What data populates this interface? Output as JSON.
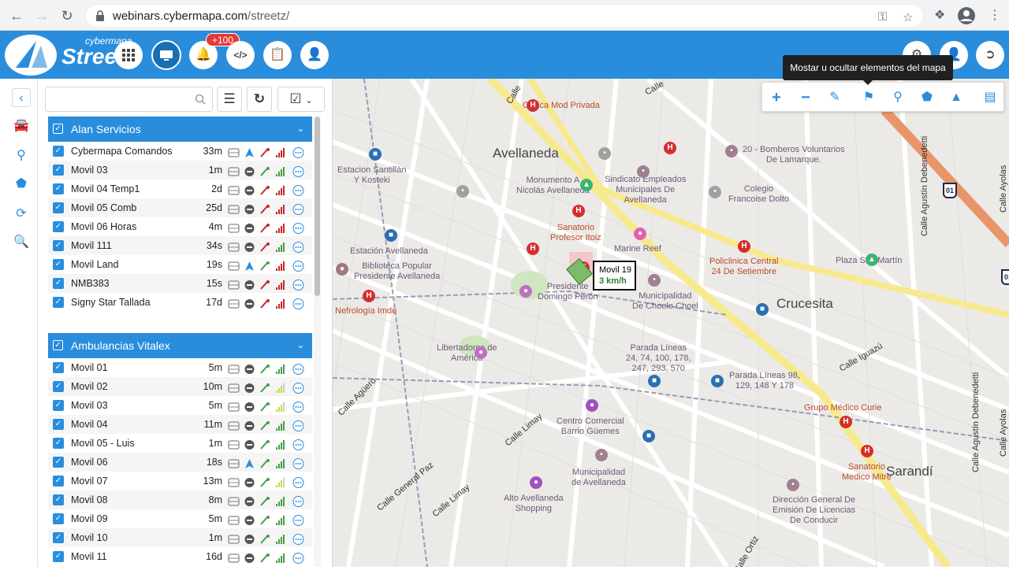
{
  "browser": {
    "url_domain": "webinars.cybermapa.com",
    "url_path": "/streetz/"
  },
  "header": {
    "logo_brand": "cybermapa",
    "logo_product": "Street",
    "notifications_badge": "+100"
  },
  "panel": {
    "search": {
      "value": "",
      "placeholder": ""
    },
    "groups": [
      {
        "name": "Alan Servicios",
        "rows": [
          {
            "name": "Cybermapa Comandos",
            "time": "33m"
          },
          {
            "name": "Movil 03",
            "time": "1m"
          },
          {
            "name": "Movil 04 Temp1",
            "time": "2d"
          },
          {
            "name": "Movil 05 Comb",
            "time": "25d"
          },
          {
            "name": "Movil 06 Horas",
            "time": "4m"
          },
          {
            "name": "Movil 111",
            "time": "34s"
          },
          {
            "name": "Movil Land",
            "time": "19s"
          },
          {
            "name": "NMB383",
            "time": "15s"
          },
          {
            "name": "Signy Star Tallada",
            "time": "17d"
          }
        ]
      },
      {
        "name": "Ambulancias Vitalex",
        "rows": [
          {
            "name": "Movil 01",
            "time": "5m"
          },
          {
            "name": "Movil 02",
            "time": "10m"
          },
          {
            "name": "Movil 03",
            "time": "5m"
          },
          {
            "name": "Movil 04",
            "time": "11m"
          },
          {
            "name": "Movil 05 - Luis",
            "time": "1m"
          },
          {
            "name": "Movil 06",
            "time": "18s"
          },
          {
            "name": "Movil 07",
            "time": "13m"
          },
          {
            "name": "Movil 08",
            "time": "8m"
          },
          {
            "name": "Movil 09",
            "time": "5m"
          },
          {
            "name": "Movil 10",
            "time": "1m"
          },
          {
            "name": "Movil 11",
            "time": "16d"
          }
        ]
      }
    ]
  },
  "map": {
    "tooltip": "Mostar u ocultar elementos del mapa",
    "vehicle_card": {
      "name": "Movil 19",
      "speed": "3 km/h"
    },
    "labels": {
      "avellaneda": "Avellaneda",
      "crucesita": "Crucesita",
      "sarandi": "Sarandí",
      "clinica": "Clinica Mod Privada",
      "bomberos1": "20 - Bomberos Voluntarios",
      "bomberos2": "De Lamarque.",
      "est_santillan1": "Estacion Santillán",
      "est_santillan2": "Y Kosteki",
      "monumento1": "Monumento A",
      "monumento2": "Nicolás Avellaneda",
      "sindicato1": "Sindicato Empleados",
      "sindicato2": "Municipales De",
      "sindicato3": "Avellaneda",
      "colegio1": "Colegio",
      "colegio2": "Francoise Dolto",
      "sanatorio1": "Sanatorio",
      "sanatorio2": "Profesor Itoiz",
      "est_avellaneda": "Estación Avellaneda",
      "marine_reef": "Marine Reef",
      "policlinica1": "Policlinica Central",
      "policlinica2": "24 De Setiembre",
      "plaza_sm": "Plaza San Martín",
      "biblioteca1": "Biblioteca Popular",
      "biblioteca2": "Presidente Avellaneda",
      "presidente1": "Presidente",
      "presidente2": "Domingo Perón",
      "municipalidad_cc1": "Municipalidad",
      "municipalidad_cc2": "De Choele Choel",
      "nefrologia": "Nefrología Imde",
      "libertadores1": "Libertadores de",
      "libertadores2": "América",
      "parada1a": "Parada Líneas",
      "parada1b": "24, 74, 100, 178,",
      "parada1c": "247, 293, 570",
      "parada2a": "Parada Líneas 98,",
      "parada2b": "129, 148 Y 178",
      "calle_iguazu": "Calle Iguazú",
      "grupo_curie": "Grupo Médico Curie",
      "sanatorio_mitre1": "Sanatorio",
      "sanatorio_mitre2": "Medico Mitre",
      "centro1": "Centro Comercial",
      "centro2": "Barrio Güemes",
      "calle_limay": "Calle Limay",
      "calle_limay2": "Calle Limay",
      "calle_gral_paz": "Calle General Paz",
      "municipalidad_av1": "Municipalidad",
      "municipalidad_av2": "de Avellaneda",
      "alto1": "Alto Avellaneda",
      "alto2": "Shopping",
      "direccion1": "Dirección General De",
      "direccion2": "Emisión De Licencias",
      "direccion3": "De Conducir",
      "calle_agustin": "Calle Agustín Debenedetti",
      "calle_ayolas": "Calle Ayolas",
      "calle_ortiz": "Calle Ortiz",
      "calle_agüero": "Calle Agüero",
      "calle_top": "Calle",
      "route": "01"
    }
  }
}
